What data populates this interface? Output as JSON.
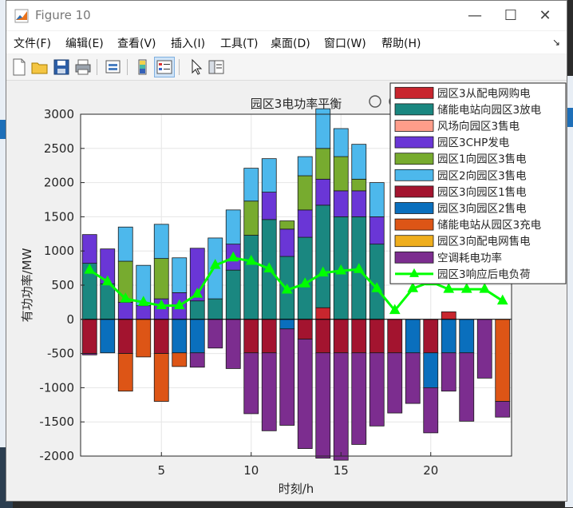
{
  "window": {
    "title": "Figure 10"
  },
  "menu": [
    "文件(F)",
    "编辑(E)",
    "查看(V)",
    "插入(I)",
    "工具(T)",
    "桌面(D)",
    "窗口(W)",
    "帮助(H)"
  ],
  "toolbar_icons": [
    "new-figure-icon",
    "open-file-icon",
    "save-icon",
    "print-icon",
    "link-icon",
    "colorbar-icon",
    "legend-icon",
    "pointer-icon",
    "property-inspector-icon"
  ],
  "axes_toolbar_icons": [
    "brush-icon",
    "data-cursor-icon",
    "zoom-in-icon",
    "pan-icon",
    "zoom-out-icon",
    "home-icon"
  ],
  "colors": {
    "window_bg": "#f0f0f0",
    "axes_bg": "#ffffff",
    "grid": "#e6e6e6",
    "load_line": "#00ff00"
  },
  "chart_data": {
    "type": "bar",
    "stacked": true,
    "title": "园区3电功率平衡",
    "xlabel": "时刻/h",
    "ylabel": "有功功率/MW",
    "xlim": [
      0.5,
      24.5
    ],
    "ylim": [
      -2000,
      3000
    ],
    "xticks": [
      5,
      10,
      15,
      20
    ],
    "yticks": [
      -2000,
      -1500,
      -1000,
      -500,
      0,
      500,
      1000,
      1500,
      2000,
      2500,
      3000
    ],
    "x": [
      1,
      2,
      3,
      4,
      5,
      6,
      7,
      8,
      9,
      10,
      11,
      12,
      13,
      14,
      15,
      16,
      17,
      18,
      19,
      20,
      21,
      22,
      23,
      24
    ],
    "grid": true,
    "legend_position": "top-right",
    "positive_series": [
      {
        "name": "园区3从配电网购电",
        "color": "#c8262e",
        "values": [
          0,
          0,
          0,
          0,
          0,
          0,
          0,
          0,
          0,
          0,
          0,
          0,
          0,
          170,
          0,
          0,
          0,
          0,
          0,
          0,
          110,
          0,
          0,
          0
        ]
      },
      {
        "name": "储能电站向园区3放电",
        "color": "#1a8780",
        "values": [
          820,
          520,
          0,
          0,
          0,
          0,
          270,
          300,
          720,
          1230,
          1460,
          920,
          1200,
          1500,
          1500,
          1500,
          1100,
          0,
          0,
          0,
          0,
          0,
          0,
          0
        ]
      },
      {
        "name": "风场向园区3售电",
        "color": "#ff9d8a",
        "values": [
          0,
          0,
          0,
          0,
          0,
          0,
          0,
          0,
          0,
          0,
          0,
          0,
          0,
          0,
          0,
          0,
          0,
          0,
          0,
          0,
          0,
          0,
          0,
          0
        ]
      },
      {
        "name": "园区3CHP发电",
        "color": "#6a36d6",
        "values": [
          420,
          510,
          250,
          200,
          300,
          390,
          770,
          0,
          380,
          0,
          400,
          400,
          400,
          380,
          380,
          380,
          400,
          0,
          0,
          0,
          0,
          0,
          0,
          0
        ]
      },
      {
        "name": "园区1向园区3售电",
        "color": "#77ab2f",
        "values": [
          0,
          0,
          600,
          0,
          590,
          0,
          0,
          0,
          0,
          500,
          0,
          120,
          500,
          450,
          500,
          170,
          0,
          0,
          0,
          0,
          0,
          0,
          0,
          0
        ]
      },
      {
        "name": "园区2向园区3售电",
        "color": "#4db8ec",
        "values": [
          0,
          0,
          500,
          590,
          500,
          510,
          0,
          890,
          500,
          480,
          490,
          0,
          280,
          580,
          410,
          510,
          500,
          0,
          0,
          0,
          0,
          0,
          0,
          0
        ]
      }
    ],
    "negative_series": [
      {
        "name": "园区3向园区1售电",
        "color": "#a3142f",
        "values": [
          -500,
          0,
          -500,
          0,
          -500,
          0,
          0,
          0,
          0,
          -490,
          -490,
          0,
          -290,
          -490,
          -490,
          -490,
          -490,
          -490,
          0,
          -490,
          0,
          0,
          0,
          0
        ]
      },
      {
        "name": "园区3向园区2售电",
        "color": "#0a6fbd",
        "values": [
          0,
          -490,
          0,
          0,
          0,
          -490,
          -490,
          0,
          0,
          0,
          0,
          -140,
          0,
          0,
          0,
          0,
          0,
          0,
          -490,
          -510,
          -490,
          -490,
          0,
          0
        ]
      },
      {
        "name": "储能电站从园区3充电",
        "color": "#dd5516",
        "values": [
          0,
          0,
          -550,
          -550,
          -700,
          -200,
          0,
          0,
          0,
          0,
          0,
          0,
          0,
          0,
          0,
          0,
          0,
          0,
          0,
          0,
          0,
          0,
          0,
          -1200
        ]
      },
      {
        "name": "园区3向配电网售电",
        "color": "#efae1d",
        "values": [
          0,
          0,
          0,
          0,
          0,
          0,
          0,
          0,
          0,
          0,
          0,
          0,
          0,
          0,
          0,
          0,
          0,
          0,
          0,
          0,
          0,
          0,
          0,
          0
        ]
      },
      {
        "name": "空调耗电功率",
        "color": "#7c2d8f",
        "values": [
          -20,
          0,
          0,
          0,
          0,
          0,
          -210,
          -420,
          -720,
          -890,
          -1140,
          -1410,
          -1600,
          -1540,
          -1570,
          -1340,
          -1070,
          -880,
          -740,
          -660,
          -560,
          -1000,
          -860,
          -230
        ]
      }
    ],
    "line_series": {
      "name": "园区3响应后电负荷",
      "color": "#00ff00",
      "values": [
        720,
        550,
        300,
        250,
        200,
        200,
        370,
        790,
        900,
        850,
        740,
        430,
        520,
        680,
        710,
        730,
        450,
        130,
        450,
        550,
        440,
        440,
        440,
        270
      ]
    }
  }
}
